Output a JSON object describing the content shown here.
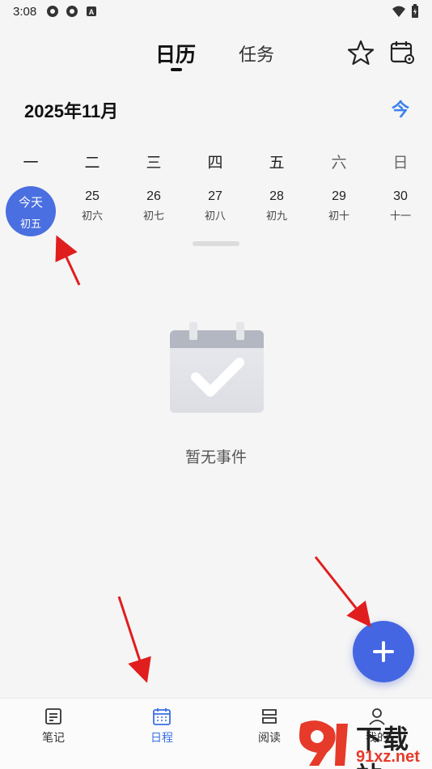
{
  "status_bar": {
    "time": "3:08",
    "icons": [
      "app-icon-1",
      "app-icon-2",
      "a-icon"
    ],
    "right_icons": [
      "wifi-icon",
      "battery-icon"
    ]
  },
  "header": {
    "tabs": [
      {
        "label": "日历",
        "active": true
      },
      {
        "label": "任务",
        "active": false
      }
    ],
    "actions": [
      "star-icon",
      "calendar-settings-icon"
    ]
  },
  "calendar": {
    "month_title": "2025年11月",
    "today_button": "今",
    "weekdays": [
      "一",
      "二",
      "三",
      "四",
      "五",
      "六",
      "日"
    ],
    "dates": [
      {
        "num": "今天",
        "lunar": "初五",
        "today": true
      },
      {
        "num": "25",
        "lunar": "初六"
      },
      {
        "num": "26",
        "lunar": "初七"
      },
      {
        "num": "27",
        "lunar": "初八"
      },
      {
        "num": "28",
        "lunar": "初九"
      },
      {
        "num": "29",
        "lunar": "初十"
      },
      {
        "num": "30",
        "lunar": "十一"
      }
    ]
  },
  "empty_state": {
    "text": "暂无事件"
  },
  "bottom_nav": {
    "items": [
      {
        "label": "笔记",
        "icon": "note-icon",
        "active": false
      },
      {
        "label": "日程",
        "icon": "schedule-icon",
        "active": true
      },
      {
        "label": "阅读",
        "icon": "reading-icon",
        "active": false
      },
      {
        "label": "我的",
        "icon": "profile-icon",
        "active": false
      }
    ]
  },
  "watermark": {
    "text": "下载站",
    "domain": "91xz.net"
  },
  "colors": {
    "accent": "#4466e2",
    "today_bg": "#4a6fe0",
    "arrow": "#e01e1e"
  }
}
